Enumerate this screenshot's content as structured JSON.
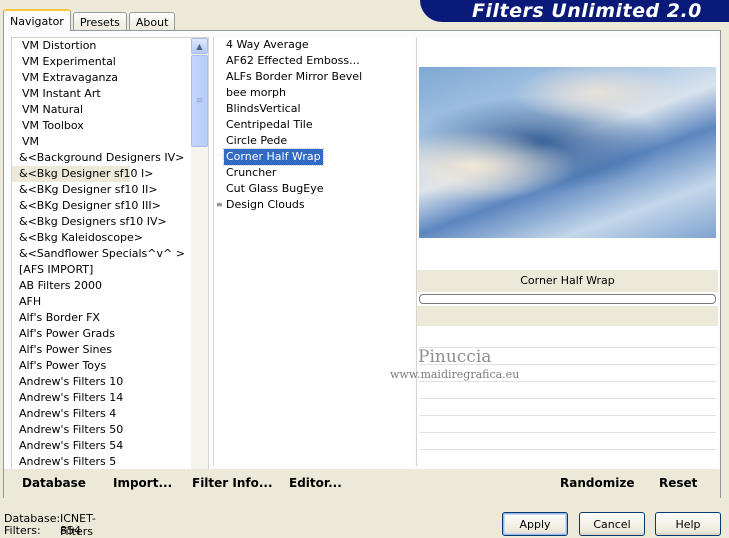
{
  "banner": {
    "title": "Filters Unlimited 2.0"
  },
  "tabs": [
    {
      "label": "Navigator",
      "active": true
    },
    {
      "label": "Presets",
      "active": false
    },
    {
      "label": "About",
      "active": false
    }
  ],
  "categories": {
    "selected": "&<Bkg Designer sf10 I>",
    "items": [
      "VM Distortion",
      "VM Experimental",
      "VM Extravaganza",
      "VM Instant Art",
      "VM Natural",
      "VM Toolbox",
      "VM",
      "&<Background Designers IV>",
      "&<Bkg Designer sf10 I>",
      "&<BKg Designer sf10 II>",
      "&<BKg Designer sf10 III>",
      "&<Bkg Designers sf10 IV>",
      "&<Bkg Kaleidoscope>",
      "&<Sandflower Specials^v^ >",
      "[AFS IMPORT]",
      "AB Filters 2000",
      "AFH",
      "Alf's Border FX",
      "Alf's Power Grads",
      "Alf's Power Sines",
      "Alf's Power Toys",
      "Andrew's Filters 10",
      "Andrew's Filters 14",
      "Andrew's Filters 4",
      "Andrew's Filters 50",
      "Andrew's Filters 54",
      "Andrew's Filters 5"
    ]
  },
  "filters": {
    "selected": "Corner Half Wrap",
    "items": [
      "4 Way Average",
      "AF62 Effected Emboss...",
      "ALFs Border Mirror Bevel",
      "bee morph",
      "BlindsVertical",
      "Centripedal Tile",
      "Circle Pede",
      "Corner Half Wrap",
      "Cruncher",
      "Cut Glass  BugEye",
      "Design Clouds"
    ]
  },
  "preview": {
    "filter_name": "Corner Half Wrap"
  },
  "watermark": {
    "name": "Pinuccia",
    "url": "www.maidiregrafica.eu"
  },
  "bottom_bar": {
    "database": "Database",
    "import": "Import...",
    "filter_info": "Filter Info...",
    "editor": "Editor...",
    "randomize": "Randomize",
    "reset": "Reset"
  },
  "status": {
    "database_label": "Database:",
    "database_value": "ICNET-Filters",
    "filters_label": "Filters:",
    "filters_value": "854"
  },
  "buttons": {
    "apply": "Apply",
    "cancel": "Cancel",
    "help": "Help"
  }
}
